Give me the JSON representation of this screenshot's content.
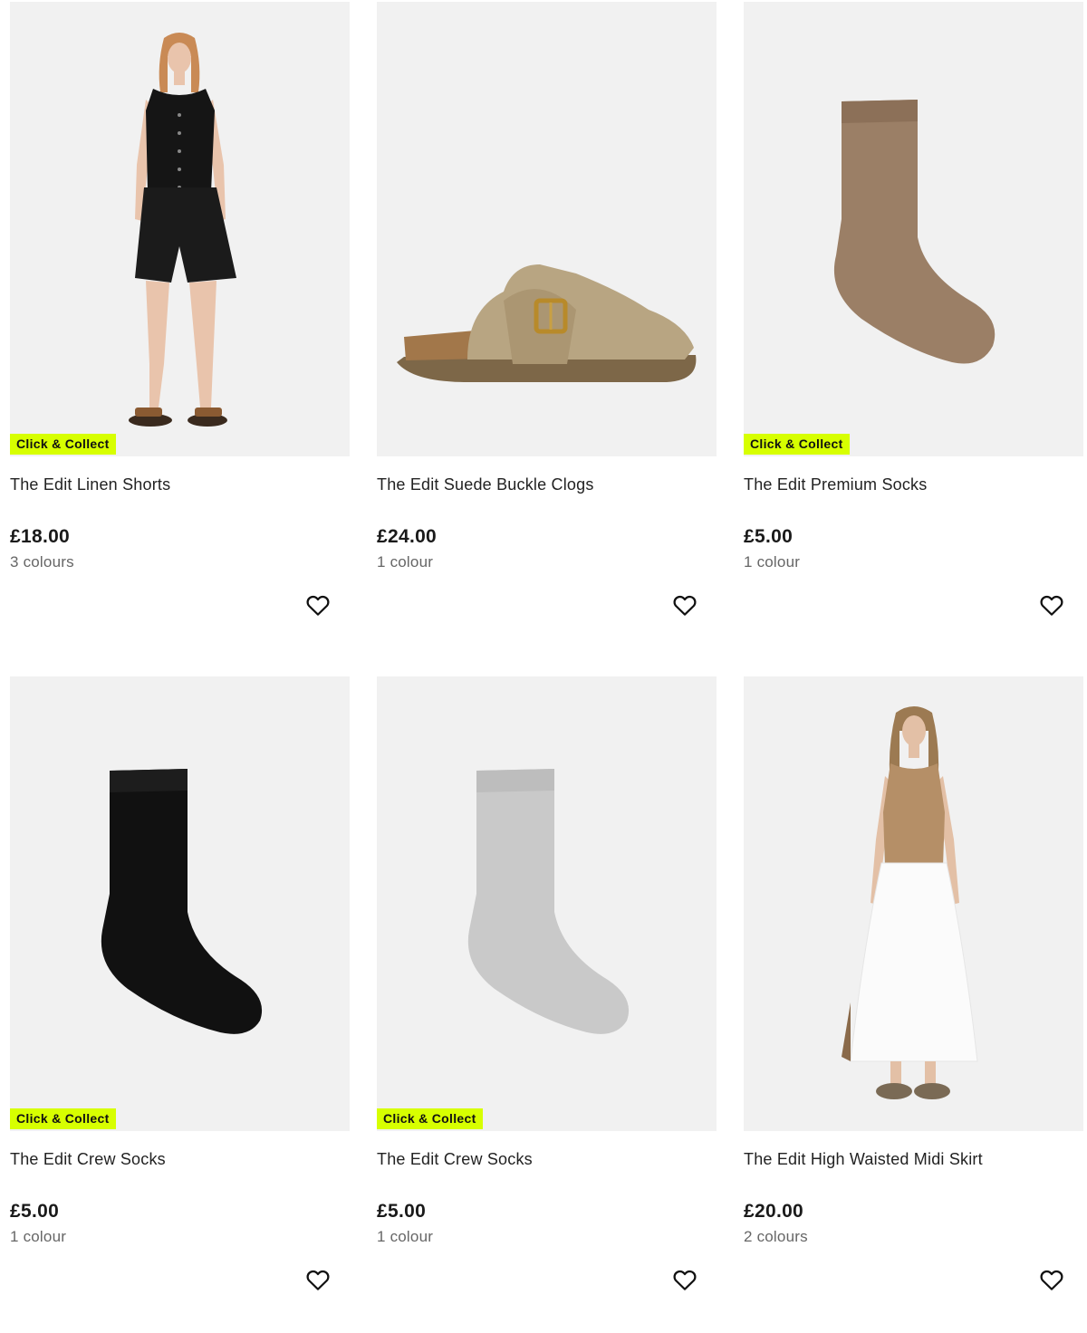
{
  "products": [
    {
      "name": "The Edit Linen Shorts",
      "price": "£18.00",
      "colours": "3 colours",
      "badge": "Click & Collect",
      "image": "model-linen-shorts-image",
      "wishlist_icon": "heart-outline-icon"
    },
    {
      "name": "The Edit Suede Buckle Clogs",
      "price": "£24.00",
      "colours": "1 colour",
      "badge": "",
      "image": "suede-buckle-clog-image",
      "wishlist_icon": "heart-outline-icon"
    },
    {
      "name": "The Edit Premium Socks",
      "price": "£5.00",
      "colours": "1 colour",
      "badge": "Click & Collect",
      "image": "brown-sock-image",
      "wishlist_icon": "heart-outline-icon"
    },
    {
      "name": "The Edit Crew Socks",
      "price": "£5.00",
      "colours": "1 colour",
      "badge": "Click & Collect",
      "image": "black-sock-image",
      "wishlist_icon": "heart-outline-icon"
    },
    {
      "name": "The Edit Crew Socks",
      "price": "£5.00",
      "colours": "1 colour",
      "badge": "Click & Collect",
      "image": "grey-sock-image",
      "wishlist_icon": "heart-outline-icon"
    },
    {
      "name": "The Edit High Waisted Midi Skirt",
      "price": "£20.00",
      "colours": "2 colours",
      "badge": "",
      "image": "model-midi-skirt-image",
      "wishlist_icon": "heart-outline-icon"
    }
  ],
  "colors": {
    "badge_background": "#d7ff00",
    "image_background": "#f1f1f1",
    "price_text": "#1a1a1a",
    "secondary_text": "#666666"
  }
}
